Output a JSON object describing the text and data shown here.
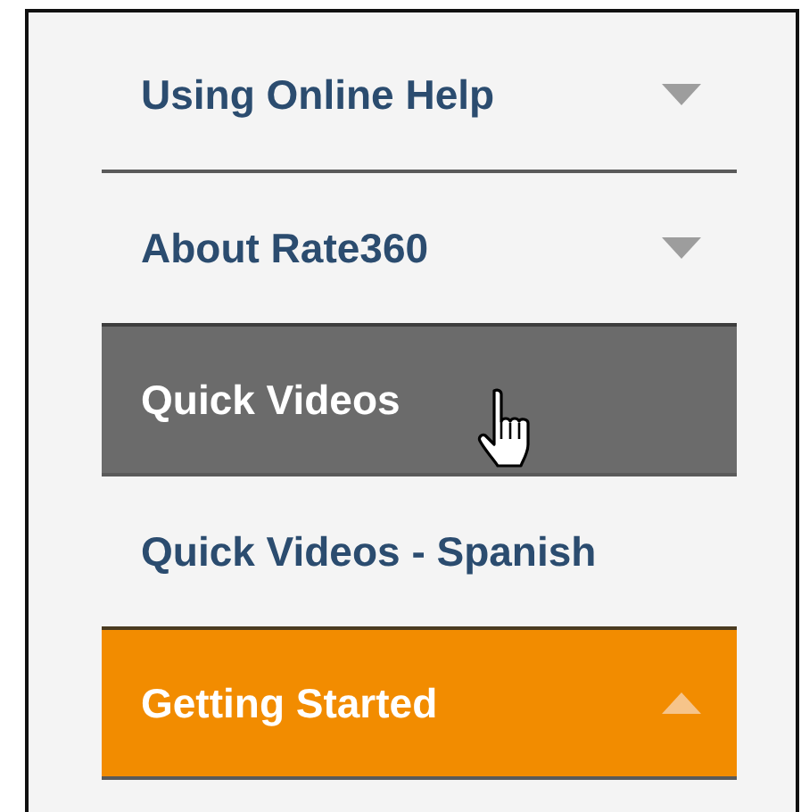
{
  "menu": {
    "items": [
      {
        "label": "Using Online Help",
        "expanded": false,
        "selected": false,
        "hovered": false
      },
      {
        "label": "About Rate360",
        "expanded": false,
        "selected": false,
        "hovered": false
      },
      {
        "label": "Quick Videos",
        "selected": false,
        "hovered": true
      },
      {
        "label": "Quick Videos - Spanish",
        "selected": false,
        "hovered": false
      },
      {
        "label": "Getting Started",
        "expanded": true,
        "selected": true,
        "hovered": false
      }
    ]
  }
}
